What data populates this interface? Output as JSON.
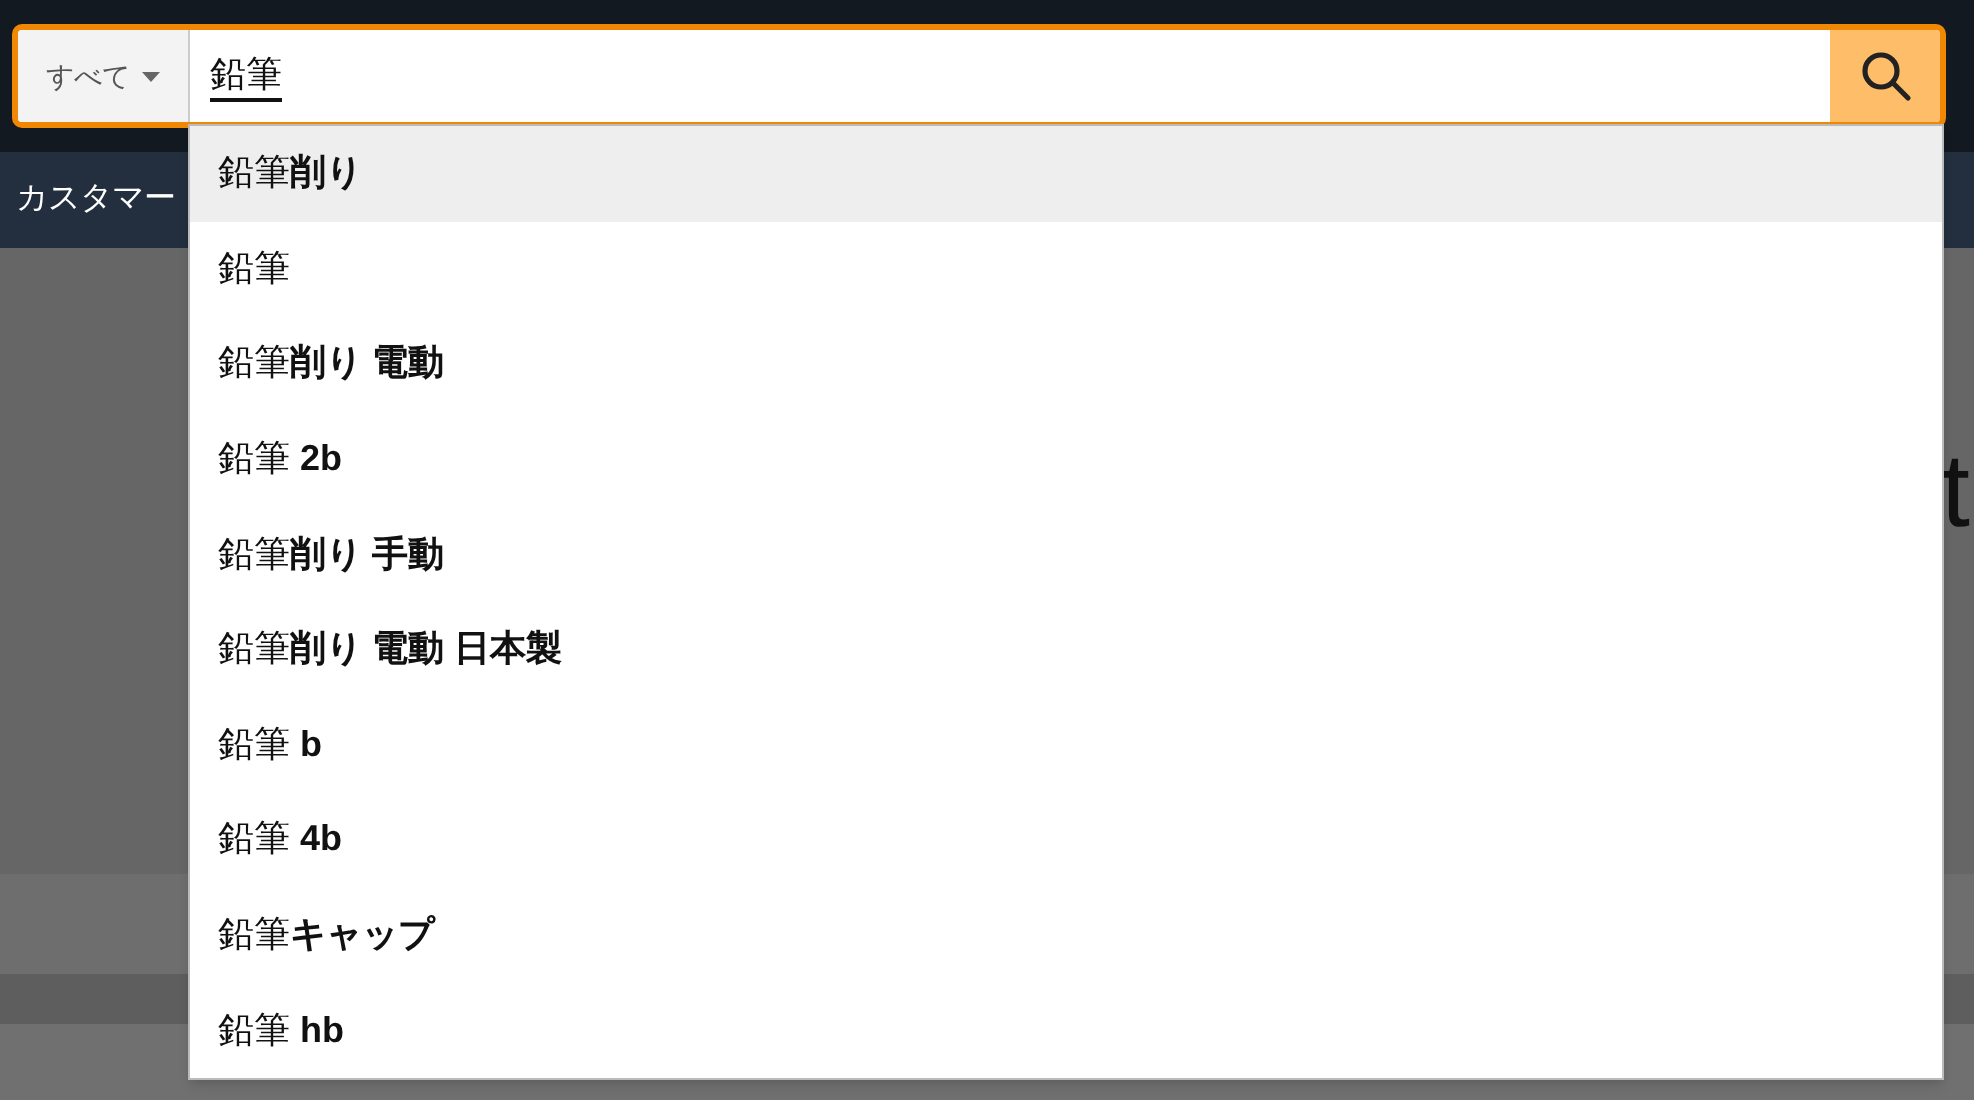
{
  "search": {
    "category": "すべて",
    "value": "鉛筆",
    "composing": true
  },
  "nav": {
    "items": [
      "カスタマー"
    ]
  },
  "background": {
    "headline_fragment": "t"
  },
  "suggestions": [
    {
      "text": "鉛筆**削り**",
      "selected": true
    },
    {
      "text": "鉛筆",
      "selected": false
    },
    {
      "text": "鉛筆**削り 電動**",
      "selected": false
    },
    {
      "text": "鉛筆 **2b**",
      "selected": false
    },
    {
      "text": "鉛筆**削り 手動**",
      "selected": false
    },
    {
      "text": "鉛筆**削り 電動 日本製**",
      "selected": false
    },
    {
      "text": "鉛筆 **b**",
      "selected": false
    },
    {
      "text": "鉛筆 **4b**",
      "selected": false
    },
    {
      "text": "鉛筆**キャップ**",
      "selected": false
    },
    {
      "text": "鉛筆 **hb**",
      "selected": false
    }
  ]
}
